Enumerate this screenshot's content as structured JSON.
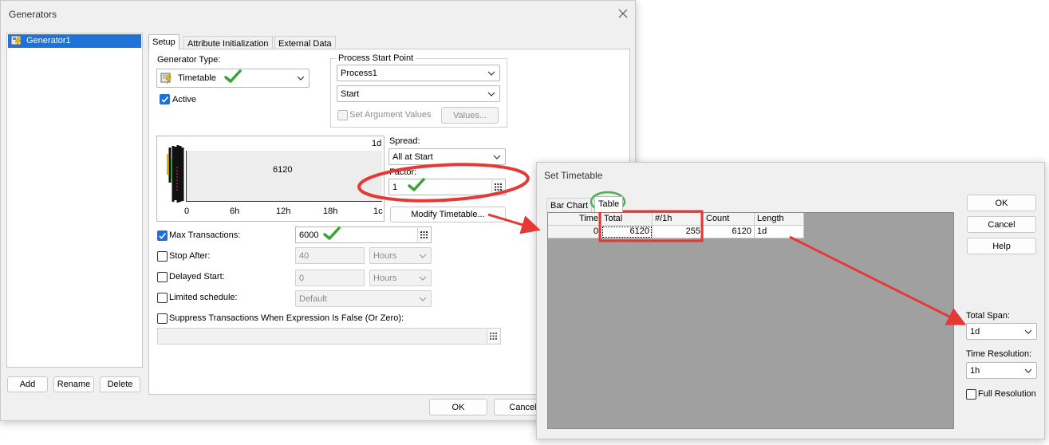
{
  "generators": {
    "title": "Generators",
    "list": [
      "Generator1"
    ],
    "buttons": {
      "add": "Add",
      "rename": "Rename",
      "delete": "Delete",
      "ok": "OK",
      "cancel": "Cancel"
    },
    "tabs": [
      "Setup",
      "Attribute Initialization",
      "External Data"
    ],
    "setup": {
      "generator_type_label": "Generator Type:",
      "generator_type_value": "Timetable",
      "active_label": "Active",
      "process_start_point_label": "Process Start Point",
      "process_value": "Process1",
      "start_value": "Start",
      "set_argument_values_label": "Set Argument Values",
      "values_button": "Values...",
      "spread_label": "Spread:",
      "spread_value": "All at Start",
      "factor_label": "Factor:",
      "factor_value": "1",
      "modify_timetable_button": "Modify Timetable...",
      "chart": {
        "top_right_label": "1d",
        "bar_value": "6120",
        "x_ticks": [
          "0",
          "6h",
          "12h",
          "18h",
          "1c"
        ]
      },
      "max_transactions_label": "Max Transactions:",
      "max_transactions_value": "6000",
      "stop_after_label": "Stop After:",
      "stop_after_value": "40",
      "stop_after_unit": "Hours",
      "delayed_start_label": "Delayed Start:",
      "delayed_start_value": "0",
      "delayed_start_unit": "Hours",
      "limited_schedule_label": "Limited schedule:",
      "limited_schedule_value": "Default",
      "suppress_label": "Suppress Transactions When Expression Is False (Or Zero):"
    }
  },
  "set_timetable": {
    "title": "Set Timetable",
    "tabs": [
      "Bar Chart",
      "Table"
    ],
    "columns": [
      "Time",
      "Total",
      "#/1h",
      "Count",
      "Length"
    ],
    "rows": [
      {
        "time": "0",
        "total": "6120",
        "per_hour": "255",
        "count": "6120",
        "length": "1d"
      }
    ],
    "buttons": {
      "ok": "OK",
      "cancel": "Cancel",
      "help": "Help"
    },
    "total_span_label": "Total Span:",
    "total_span_value": "1d",
    "time_resolution_label": "Time Resolution:",
    "time_resolution_value": "1h",
    "full_resolution_label": "Full Resolution"
  },
  "colors": {
    "annotation_red": "#e53935",
    "highlight_green": "#4caf50",
    "checkmark_green": "#3aa335",
    "accent_blue": "#1e6fd9"
  }
}
